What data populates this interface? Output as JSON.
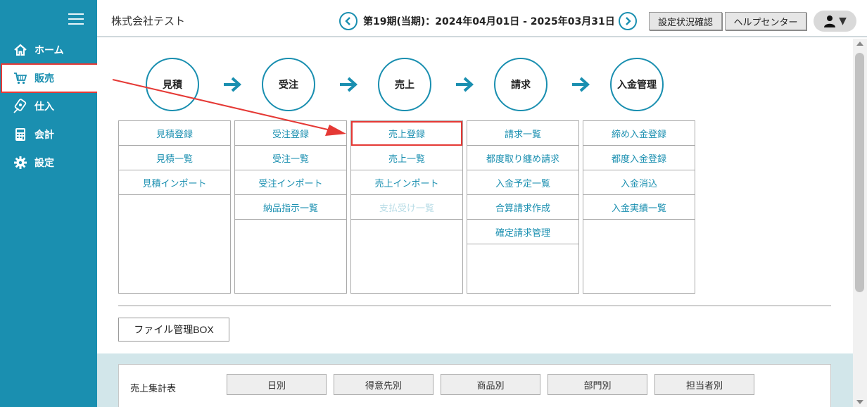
{
  "colors": {
    "accent": "#1a8fb0",
    "highlight": "#e53935"
  },
  "sidebar": {
    "items": [
      {
        "label": "ホーム",
        "icon": "home-icon"
      },
      {
        "label": "販売",
        "icon": "cart-icon",
        "active": true
      },
      {
        "label": "仕入",
        "icon": "purchase-icon"
      },
      {
        "label": "会計",
        "icon": "calculator-icon"
      },
      {
        "label": "設定",
        "icon": "gear-icon"
      }
    ]
  },
  "header": {
    "company": "株式会社テスト",
    "period": "第19期(当期)：2024年04月01日 - 2025年03月31日",
    "settings_status_label": "設定状況確認",
    "help_center_label": "ヘルプセンター",
    "user_menu_caret": "▼"
  },
  "flow": {
    "steps": [
      "見積",
      "受注",
      "売上",
      "請求",
      "入金管理"
    ]
  },
  "menu": {
    "columns": [
      {
        "items": [
          {
            "label": "見積登録"
          },
          {
            "label": "見積一覧"
          },
          {
            "label": "見積インポート"
          }
        ]
      },
      {
        "items": [
          {
            "label": "受注登録"
          },
          {
            "label": "受注一覧"
          },
          {
            "label": "受注インポート"
          },
          {
            "label": "納品指示一覧"
          }
        ]
      },
      {
        "items": [
          {
            "label": "売上登録",
            "highlight": true
          },
          {
            "label": "売上一覧"
          },
          {
            "label": "売上インポート"
          },
          {
            "label": "支払受け一覧",
            "disabled": true
          }
        ]
      },
      {
        "items": [
          {
            "label": "請求一覧"
          },
          {
            "label": "都度取り纏め請求"
          },
          {
            "label": "入金予定一覧"
          },
          {
            "label": "合算請求作成"
          },
          {
            "label": "確定請求管理"
          }
        ]
      },
      {
        "items": [
          {
            "label": "締め入金登録"
          },
          {
            "label": "都度入金登録"
          },
          {
            "label": "入金消込"
          },
          {
            "label": "入金実績一覧"
          }
        ]
      }
    ]
  },
  "file_box_label": "ファイル管理BOX",
  "summary": {
    "label": "売上集計表",
    "buttons": [
      "日別",
      "得意先別",
      "商品別",
      "部門別",
      "担当者別"
    ]
  }
}
